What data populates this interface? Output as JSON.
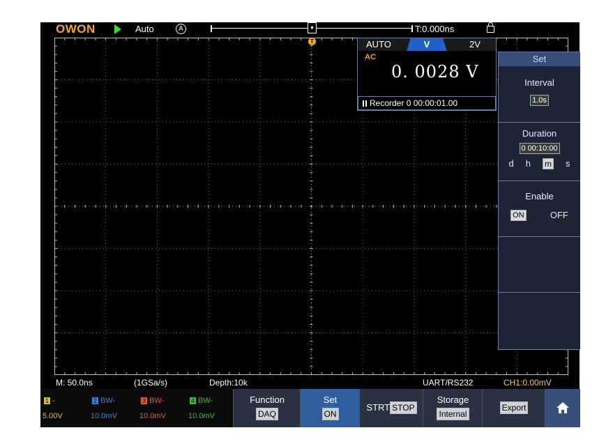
{
  "top_bar": {
    "brand": "OWON",
    "trigger_mode": "Auto",
    "auto_icon_glyph": "A",
    "time_offset": "T:0.000ns"
  },
  "trigger_marker": "T",
  "meter": {
    "tab_mode": "AUTO",
    "tab_unit": "V",
    "tab_range": "2V",
    "coupling": "AC",
    "value": "0. 0028  V",
    "recorder": "Recorder 0 00:00:01.00"
  },
  "menu": {
    "title": "Set",
    "interval_label": "Interval",
    "interval_value": "1.0s",
    "duration_label": "Duration",
    "duration_value": "0 00:10:00",
    "units": [
      "d",
      "h",
      "m",
      "s"
    ],
    "selected_unit": "m",
    "enable_label": "Enable",
    "on_label": "ON",
    "off_label": "OFF"
  },
  "status": {
    "timebase": "M: 50.0ns",
    "sample_rate": "(1GSa/s)",
    "depth": "Depth:10k",
    "port": "UART/RS232",
    "trigger_info": "CH1:0.00mV"
  },
  "channels": [
    {
      "num": "1",
      "top": "-",
      "bottom": "5.00V",
      "color": "#d8c21a"
    },
    {
      "num": "2",
      "top": "BW-",
      "bottom": "10.0mV",
      "color": "#3f7fd8"
    },
    {
      "num": "3",
      "top": "BW-",
      "bottom": "10.0mV",
      "color": "#d8612a"
    },
    {
      "num": "4",
      "top": "BW-",
      "bottom": "10.0mV",
      "color": "#3fb83f"
    }
  ],
  "buttons": {
    "function_label": "Function",
    "function_value": "DAQ",
    "set_label": "Set",
    "set_value": "ON",
    "strt_label": "STRT",
    "stop_label": "STOP",
    "storage_label": "Storage",
    "storage_value": "Internal",
    "export_label": "Export"
  },
  "colors": {
    "accent": "#f5a623",
    "meter_tab": "#1e60c8",
    "menu_bg": "#1d2436",
    "selected_button": "#2f5d9e"
  }
}
